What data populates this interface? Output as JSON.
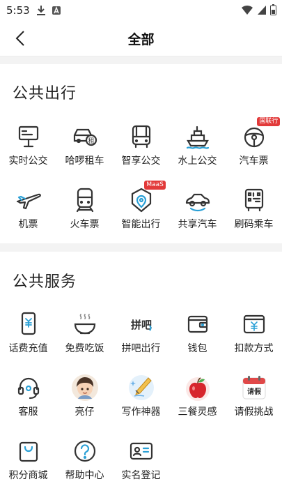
{
  "status": {
    "time": "5:53"
  },
  "header": {
    "title": "全部"
  },
  "public_transport": {
    "title": "公共出行",
    "items": [
      {
        "label": "实时公交",
        "icon": "bus-stop-sign-icon"
      },
      {
        "label": "哈啰租车",
        "icon": "car-rental-icon"
      },
      {
        "label": "智享公交",
        "icon": "bus-icon"
      },
      {
        "label": "水上公交",
        "icon": "ship-icon"
      },
      {
        "label": "汽车票",
        "icon": "steering-wheel-icon",
        "badge": "国联行"
      },
      {
        "label": "机票",
        "icon": "airplane-icon"
      },
      {
        "label": "火车票",
        "icon": "train-icon"
      },
      {
        "label": "智能出行",
        "icon": "location-pin-icon",
        "badge": "MaaS"
      },
      {
        "label": "共享汽车",
        "icon": "shared-car-icon"
      },
      {
        "label": "刷码乘车",
        "icon": "qr-bus-icon"
      }
    ]
  },
  "public_services": {
    "title": "公共服务",
    "items": [
      {
        "label": "话费充值",
        "icon": "phone-topup-icon"
      },
      {
        "label": "免费吃饭",
        "icon": "rice-bowl-icon"
      },
      {
        "label": "拼吧出行",
        "icon": "pinba-logo-icon",
        "logo_text": "拼吧"
      },
      {
        "label": "钱包",
        "icon": "wallet-icon"
      },
      {
        "label": "扣款方式",
        "icon": "payment-card-icon"
      },
      {
        "label": "客服",
        "icon": "headset-icon"
      },
      {
        "label": "亮仔",
        "icon": "avatar-boy-icon"
      },
      {
        "label": "写作神器",
        "icon": "pen-writing-icon"
      },
      {
        "label": "三餐灵感",
        "icon": "apple-icon"
      },
      {
        "label": "请假挑战",
        "icon": "calendar-leave-icon",
        "logo_text": "请假"
      },
      {
        "label": "积分商城",
        "icon": "shopping-bag-icon"
      },
      {
        "label": "帮助中心",
        "icon": "help-question-icon"
      },
      {
        "label": "实名登记",
        "icon": "id-card-icon"
      }
    ]
  }
}
